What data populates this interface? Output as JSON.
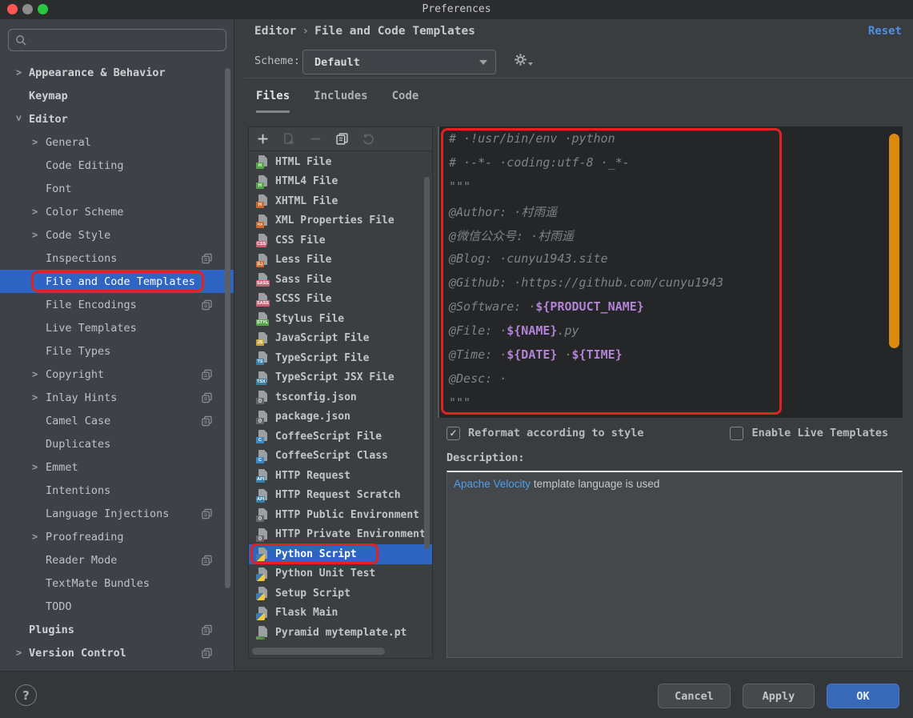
{
  "window": {
    "title": "Preferences"
  },
  "colors": {
    "selection_blue": "#2f65c2",
    "annotation_red": "#e02220",
    "editor_scrollbar_orange": "#d98a0f",
    "link_blue": "#4e9ef0",
    "reset_blue": "#4f8fe3",
    "variable_purple": "#b283d6",
    "comment_grey": "#7f8385",
    "ok_button_blue": "#3769b8"
  },
  "traffic_lights": [
    {
      "name": "close-button",
      "color": "#fc5753"
    },
    {
      "name": "minimize-button",
      "color": "#8b8b8b"
    },
    {
      "name": "zoom-button",
      "color": "#28c840"
    }
  ],
  "sidebar": {
    "search_placeholder": "",
    "items": [
      {
        "label": "Appearance & Behavior",
        "level": 0,
        "bold": true,
        "arrow": ">"
      },
      {
        "label": "Keymap",
        "level": 0,
        "bold": true
      },
      {
        "label": "Editor",
        "level": 0,
        "bold": true,
        "arrow": "v"
      },
      {
        "label": "General",
        "level": 1,
        "arrow": ">"
      },
      {
        "label": "Code Editing",
        "level": 1
      },
      {
        "label": "Font",
        "level": 1
      },
      {
        "label": "Color Scheme",
        "level": 1,
        "arrow": ">"
      },
      {
        "label": "Code Style",
        "level": 1,
        "arrow": ">"
      },
      {
        "label": "Inspections",
        "level": 1,
        "copy": true
      },
      {
        "label": "File and Code Templates",
        "level": 1,
        "selected": true,
        "annotated": true
      },
      {
        "label": "File Encodings",
        "level": 1,
        "copy": true
      },
      {
        "label": "Live Templates",
        "level": 1
      },
      {
        "label": "File Types",
        "level": 1
      },
      {
        "label": "Copyright",
        "level": 1,
        "arrow": ">",
        "copy": true
      },
      {
        "label": "Inlay Hints",
        "level": 1,
        "arrow": ">",
        "copy": true
      },
      {
        "label": "Camel Case",
        "level": 1,
        "copy": true
      },
      {
        "label": "Duplicates",
        "level": 1
      },
      {
        "label": "Emmet",
        "level": 1,
        "arrow": ">"
      },
      {
        "label": "Intentions",
        "level": 1
      },
      {
        "label": "Language Injections",
        "level": 1,
        "copy": true
      },
      {
        "label": "Proofreading",
        "level": 1,
        "arrow": ">"
      },
      {
        "label": "Reader Mode",
        "level": 1,
        "copy": true
      },
      {
        "label": "TextMate Bundles",
        "level": 1
      },
      {
        "label": "TODO",
        "level": 1
      },
      {
        "label": "Plugins",
        "level": 0,
        "bold": true,
        "copy": true
      },
      {
        "label": "Version Control",
        "level": 0,
        "bold": true,
        "arrow": ">",
        "copy": true
      }
    ]
  },
  "header": {
    "breadcrumb": {
      "section": "Editor",
      "separator": "›",
      "page": "File and Code Templates"
    },
    "reset_label": "Reset",
    "scheme_label": "Scheme:",
    "scheme_value": "Default"
  },
  "tabs": [
    {
      "label": "Files",
      "active": true
    },
    {
      "label": "Includes",
      "active": false
    },
    {
      "label": "Code",
      "active": false
    }
  ],
  "templates": {
    "toolbar": [
      {
        "name": "add-template",
        "icon": "plus",
        "enabled": true
      },
      {
        "name": "create-from-template",
        "icon": "file-plus",
        "enabled": false
      },
      {
        "name": "remove-template",
        "icon": "minus",
        "enabled": false
      },
      {
        "name": "copy-template",
        "icon": "duplicate",
        "enabled": true
      },
      {
        "name": "reset-template",
        "icon": "undo",
        "enabled": false
      }
    ],
    "items": [
      {
        "label": "HTML File",
        "icon": "html",
        "badge": "H",
        "badge_color": "#57a64a"
      },
      {
        "label": "HTML4 File",
        "icon": "html",
        "badge": "H",
        "badge_color": "#57a64a"
      },
      {
        "label": "XHTML File",
        "icon": "xhtml",
        "badge": "H",
        "badge_color": "#cf6a2f"
      },
      {
        "label": "XML Properties File",
        "icon": "xml-properties",
        "badge": "<>",
        "badge_color": "#cf6a2f"
      },
      {
        "label": "CSS File",
        "icon": "css",
        "badge": "CSS",
        "badge_color": "#ca5f74"
      },
      {
        "label": "Less File",
        "icon": "less",
        "badge": "(L)",
        "badge_color": "#cf6a2f"
      },
      {
        "label": "Sass File",
        "icon": "sass",
        "badge": "SASS",
        "badge_color": "#ca5f74"
      },
      {
        "label": "SCSS File",
        "icon": "scss",
        "badge": "SASS",
        "badge_color": "#ca5f74"
      },
      {
        "label": "Stylus File",
        "icon": "stylus",
        "badge": "STYL",
        "badge_color": "#57a64a"
      },
      {
        "label": "JavaScript File",
        "icon": "javascript",
        "badge": "JS",
        "badge_color": "#c7a53c"
      },
      {
        "label": "TypeScript File",
        "icon": "typescript",
        "badge": "TS",
        "badge_color": "#3a7fa6"
      },
      {
        "label": "TypeScript JSX File",
        "icon": "typescript-jsx",
        "badge": "TSX",
        "badge_color": "#3a7fa6"
      },
      {
        "label": "tsconfig.json",
        "icon": "json",
        "badge": "{}",
        "badge_color": "#64686b"
      },
      {
        "label": "package.json",
        "icon": "json",
        "badge": "{}",
        "badge_color": "#64686b"
      },
      {
        "label": "CoffeeScript File",
        "icon": "coffeescript",
        "badge": "C",
        "badge_color": "#3e88c4"
      },
      {
        "label": "CoffeeScript Class",
        "icon": "coffeescript",
        "badge": "C",
        "badge_color": "#3e88c4"
      },
      {
        "label": "HTTP Request",
        "icon": "http-request",
        "badge": "API",
        "badge_color": "#3a7fa6"
      },
      {
        "label": "HTTP Request Scratch",
        "icon": "http-request",
        "badge": "API",
        "badge_color": "#3a7fa6"
      },
      {
        "label": "HTTP Public Environment",
        "icon": "http-environment",
        "badge": "{}",
        "badge_color": "#64686b"
      },
      {
        "label": "HTTP Private Environment",
        "icon": "http-environment",
        "badge": "{}",
        "badge_color": "#64686b"
      },
      {
        "label": "Python Script",
        "icon": "python",
        "selected": true,
        "annotated": true
      },
      {
        "label": "Python Unit Test",
        "icon": "python"
      },
      {
        "label": "Setup Script",
        "icon": "python"
      },
      {
        "label": "Flask Main",
        "icon": "python"
      },
      {
        "label": "Pyramid mytemplate.pt",
        "icon": "pyramid"
      }
    ]
  },
  "editor": {
    "lines": [
      [
        [
          "c",
          "# ·!usr/bin/env ·python"
        ]
      ],
      [
        [
          "c",
          "# ·-*- ·coding:utf-8 ·_*-"
        ]
      ],
      [
        [
          "c",
          "\"\"\""
        ]
      ],
      [
        [
          "c",
          "@Author: ·村雨遥"
        ]
      ],
      [
        [
          "c",
          "@微信公众号: ·村雨遥"
        ]
      ],
      [
        [
          "c",
          "@Blog: ·cunyu1943.site"
        ]
      ],
      [
        [
          "c",
          "@Github: ·https://github.com/cunyu1943"
        ]
      ],
      [
        [
          "c",
          "@Software: ·"
        ],
        [
          "v",
          "${PRODUCT_NAME}"
        ]
      ],
      [
        [
          "c",
          "@File: ·"
        ],
        [
          "v",
          "${NAME}"
        ],
        [
          "c",
          ".py"
        ]
      ],
      [
        [
          "c",
          "@Time: ·"
        ],
        [
          "v",
          "${DATE}"
        ],
        [
          "c",
          " ·"
        ],
        [
          "v",
          "${TIME}"
        ]
      ],
      [
        [
          "c",
          "@Desc: ·"
        ]
      ],
      [
        [
          "c",
          "\"\"\""
        ]
      ]
    ]
  },
  "options": {
    "reformat": {
      "label": "Reformat according to style",
      "checked": true,
      "glyph": "✓"
    },
    "live_templates": {
      "label": "Enable Live Templates",
      "checked": false,
      "glyph": "✓"
    }
  },
  "description": {
    "label": "Description:",
    "link_text": "Apache Velocity",
    "text": " template language is used"
  },
  "footer": {
    "help_label": "?",
    "cancel_label": "Cancel",
    "apply_label": "Apply",
    "ok_label": "OK"
  }
}
